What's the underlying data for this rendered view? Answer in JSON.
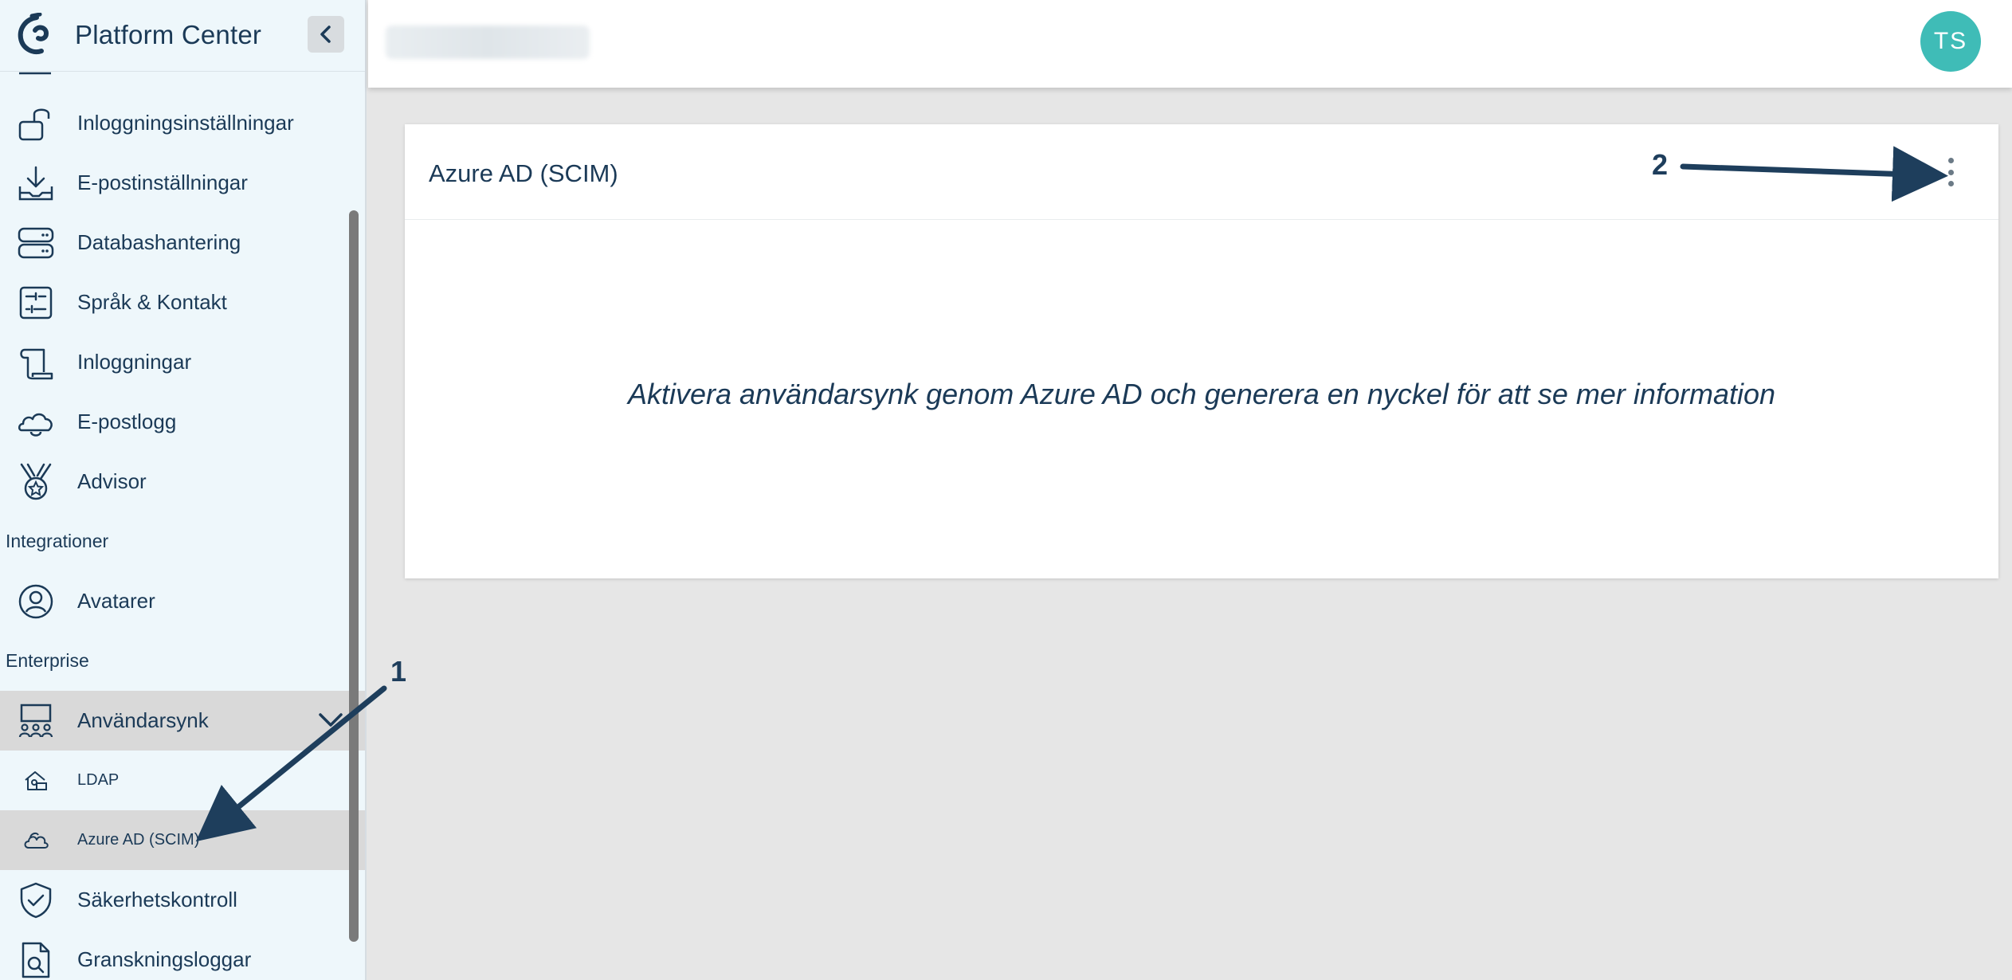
{
  "app": {
    "brand_title": "Platform Center",
    "collapse_icon": "chevron-left-icon"
  },
  "sidebar": {
    "items_top": [
      {
        "label": "Inloggningsinställningar",
        "icon": "lock-open-icon"
      },
      {
        "label": "E-postinställningar",
        "icon": "inbox-download-icon"
      },
      {
        "label": "Databashantering",
        "icon": "server-icon"
      },
      {
        "label": "Språk & Kontakt",
        "icon": "sliders-icon"
      },
      {
        "label": "Inloggningar",
        "icon": "scroll-icon"
      },
      {
        "label": "E-postlogg",
        "icon": "bell-cloud-icon"
      },
      {
        "label": "Advisor",
        "icon": "medal-icon"
      }
    ],
    "section_integrations": "Integrationer",
    "items_integrations": [
      {
        "label": "Avatarer",
        "icon": "user-circle-icon"
      }
    ],
    "section_enterprise": "Enterprise",
    "items_enterprise": [
      {
        "label": "Användarsynk",
        "icon": "people-sync-icon"
      },
      {
        "label": "LDAP",
        "icon": "house-network-icon"
      },
      {
        "label": "Azure AD (SCIM)",
        "icon": "cloud-icon"
      },
      {
        "label": "Säkerhetskontroll",
        "icon": "shield-check-icon"
      },
      {
        "label": "Granskningsloggar",
        "icon": "document-search-icon"
      }
    ]
  },
  "header": {
    "avatar_initials": "TS",
    "avatar_color": "#3fbcb7"
  },
  "card": {
    "title": "Azure AD (SCIM)",
    "message": "Aktivera användarsynk genom Azure AD och generera en nyckel för att se mer information",
    "menu_icon": "kebab-menu-icon"
  },
  "annotations": {
    "marker_1": "1",
    "marker_2": "2",
    "arrow_color": "#1e3e5c"
  }
}
